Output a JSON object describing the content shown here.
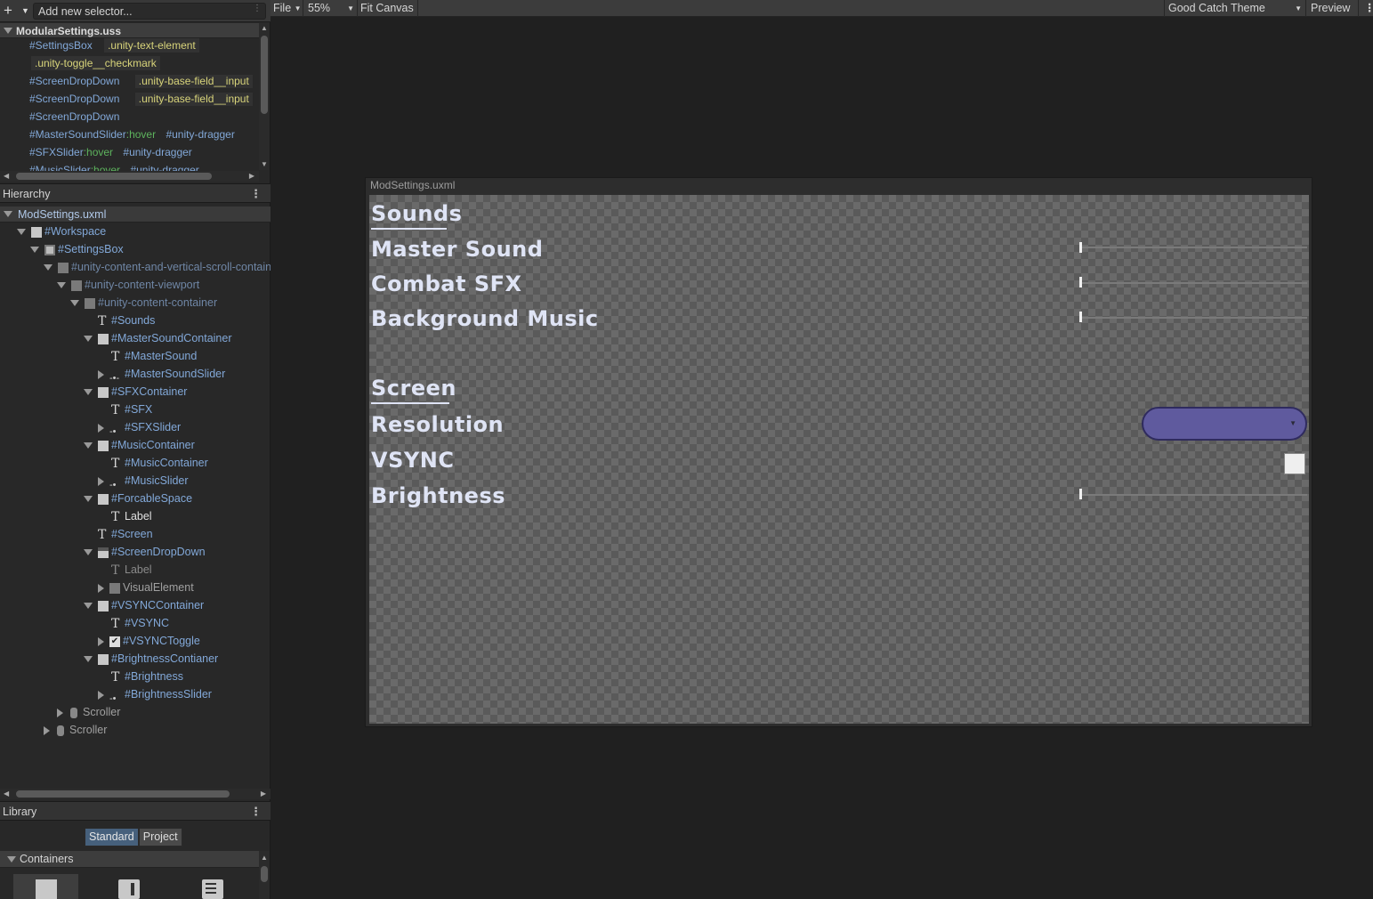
{
  "selectors": {
    "input_placeholder": "Add new selector...",
    "stylesheet": "ModularSettings.uss",
    "rows": [
      {
        "id": "#SettingsBox",
        "cls": ".unity-text-element"
      },
      {
        "cls": ".unity-toggle__checkmark"
      },
      {
        "id": "#ScreenDropDown",
        "cls": ".unity-base-field__input"
      },
      {
        "id": "#ScreenDropDown",
        "cls": ".unity-base-field__input"
      },
      {
        "id": "#ScreenDropDown"
      },
      {
        "id": "#MasterSoundSlider",
        "pseudo": ":hover",
        "id2": "#unity-dragger"
      },
      {
        "id": "#SFXSlider",
        "pseudo": ":hover",
        "id2": "#unity-dragger"
      },
      {
        "id": "#MusicSlider",
        "pseudo": ":hover",
        "id2": "#unity-dragger"
      }
    ]
  },
  "hierarchy": {
    "title": "Hierarchy",
    "root": "ModSettings.uxml",
    "items": [
      {
        "label": "#Workspace"
      },
      {
        "label": "#SettingsBox"
      },
      {
        "label": "#unity-content-and-vertical-scroll-container"
      },
      {
        "label": "#unity-content-viewport"
      },
      {
        "label": "#unity-content-container"
      },
      {
        "label": "#Sounds"
      },
      {
        "label": "#MasterSoundContainer"
      },
      {
        "label": "#MasterSound"
      },
      {
        "label": "#MasterSoundSlider"
      },
      {
        "label": "#SFXContainer"
      },
      {
        "label": "#SFX"
      },
      {
        "label": "#SFXSlider"
      },
      {
        "label": "#MusicContainer"
      },
      {
        "label": "#MusicContainer"
      },
      {
        "label": "#MusicSlider"
      },
      {
        "label": "#ForcableSpace"
      },
      {
        "label": "Label"
      },
      {
        "label": "#Screen"
      },
      {
        "label": "#ScreenDropDown"
      },
      {
        "label": "Label"
      },
      {
        "label": "VisualElement"
      },
      {
        "label": "#VSYNCContainer"
      },
      {
        "label": "#VSYNC"
      },
      {
        "label": "#VSYNCToggle"
      },
      {
        "label": "#BrightnessContianer"
      },
      {
        "label": "#Brightness"
      },
      {
        "label": "#BrightnessSlider"
      },
      {
        "label": "Scroller"
      },
      {
        "label": "Scroller"
      }
    ]
  },
  "library": {
    "title": "Library",
    "tabs": [
      "Standard",
      "Project"
    ],
    "section": "Containers"
  },
  "toolbar": {
    "file": "File",
    "zoom": "55%",
    "fit": "Fit Canvas",
    "theme": "Good Catch Theme",
    "preview": "Preview"
  },
  "canvas": {
    "doc_title": "ModSettings.uxml",
    "sounds_header": "Sounds",
    "master_sound": "Master Sound",
    "combat_sfx": "Combat SFX",
    "background_music": "Background Music",
    "screen_header": "Screen",
    "resolution": "Resolution",
    "vsync": "VSYNC",
    "brightness": "Brightness",
    "master_sound_level": 0,
    "combat_sfx_level": 0,
    "background_music_level": 0,
    "brightness_level": 0,
    "vsync_checked": false
  },
  "colors": {
    "selector_id": "#82a8d8",
    "selector_class": "#d8d47a",
    "pseudo": "#5db35d",
    "label_text": "#dfe4f5",
    "dropdown_fill": "#5f5a9e"
  }
}
